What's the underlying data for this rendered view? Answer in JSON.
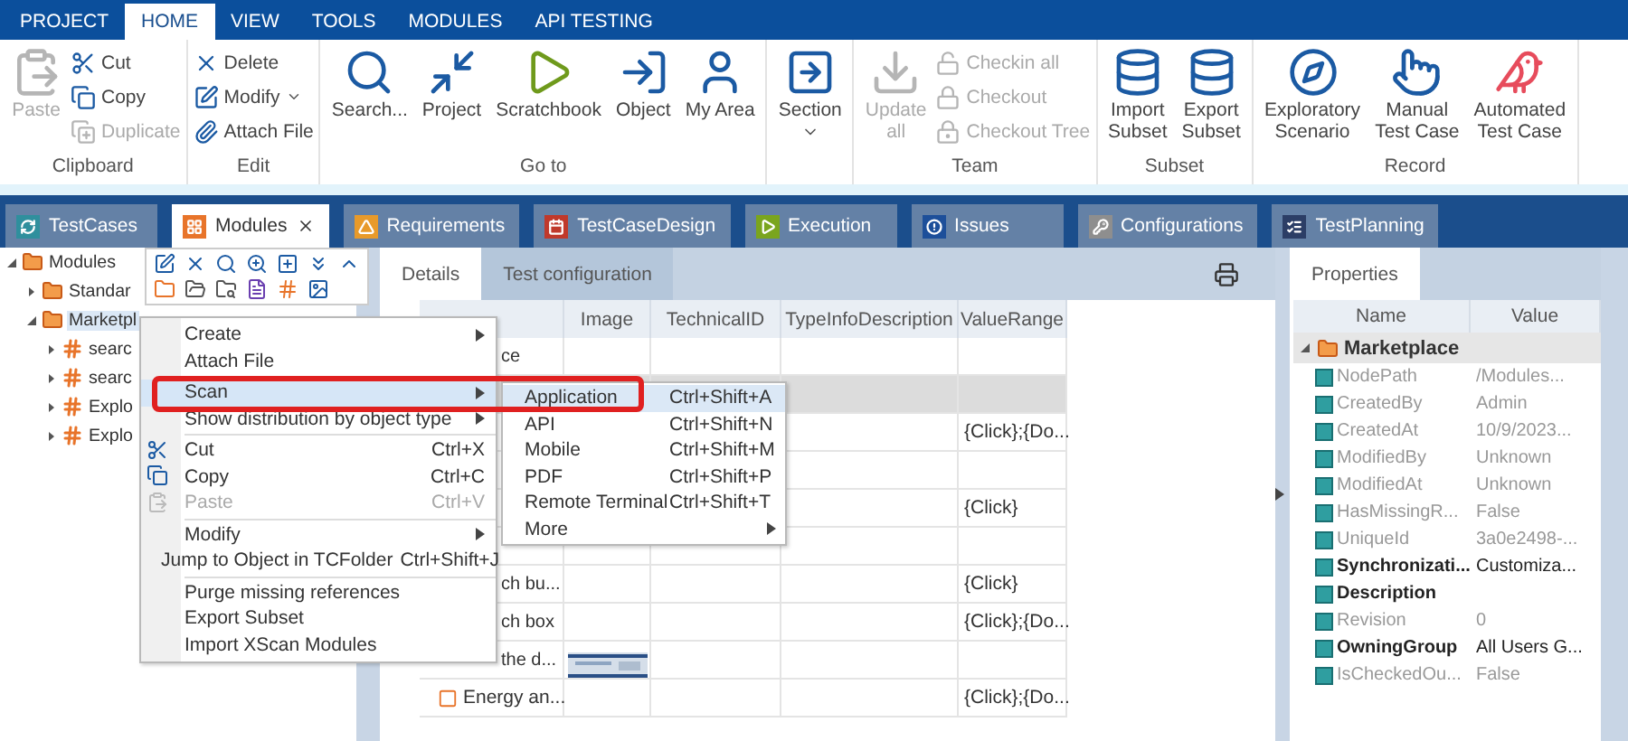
{
  "ribbon_tabs": [
    {
      "label": "PROJECT",
      "selected": false
    },
    {
      "label": "HOME",
      "selected": true
    },
    {
      "label": "VIEW",
      "selected": false
    },
    {
      "label": "TOOLS",
      "selected": false
    },
    {
      "label": "MODULES",
      "selected": false
    },
    {
      "label": "API TESTING",
      "selected": false
    }
  ],
  "ribbon_groups": [
    {
      "label": "Clipboard",
      "columns": [
        [
          {
            "label": "Paste",
            "disabled": true
          }
        ],
        [
          {
            "label": "Cut",
            "disabled": false
          },
          {
            "label": "Copy",
            "disabled": false
          },
          {
            "label": "Duplicate",
            "disabled": true
          }
        ]
      ]
    },
    {
      "label": "Edit",
      "columns": [
        [
          {
            "label": "Delete",
            "disabled": false
          },
          {
            "label": "Modify",
            "disabled": false,
            "dropdown": true
          },
          {
            "label": "Attach File",
            "disabled": false
          }
        ]
      ]
    },
    {
      "label": "Go to",
      "columns": [
        [
          {
            "label": "Search...",
            "disabled": false
          }
        ],
        [
          {
            "label": "Project",
            "disabled": false
          }
        ],
        [
          {
            "label": "Scratchbook",
            "disabled": false
          }
        ],
        [
          {
            "label": "Object",
            "disabled": false
          }
        ],
        [
          {
            "label": "My Area",
            "disabled": false
          }
        ]
      ]
    },
    {
      "columns": [
        [
          {
            "label": "Section",
            "disabled": false,
            "dropdown": true
          }
        ]
      ]
    },
    {
      "label": "Team",
      "columns": [
        [
          {
            "label": "Update\nall",
            "disabled": true
          }
        ],
        [
          {
            "label": "Checkin all",
            "disabled": true
          },
          {
            "label": "Checkout",
            "disabled": true
          },
          {
            "label": "Checkout Tree",
            "disabled": true
          }
        ]
      ]
    },
    {
      "label": "Subset",
      "columns": [
        [
          {
            "label": "Import\nSubset",
            "disabled": false
          }
        ],
        [
          {
            "label": "Export\nSubset",
            "disabled": false
          }
        ]
      ]
    },
    {
      "label": "Record",
      "columns": [
        [
          {
            "label": "Exploratory\nScenario",
            "disabled": false
          }
        ],
        [
          {
            "label": "Manual\nTest Case",
            "disabled": false
          }
        ],
        [
          {
            "label": "Automated\nTest Case",
            "disabled": false
          }
        ]
      ]
    }
  ],
  "doc_tabs": [
    {
      "label": "TestCases",
      "selected": false,
      "color": "#2f8f9d"
    },
    {
      "label": "Modules",
      "selected": true,
      "closable": true,
      "color": "#e8742a"
    },
    {
      "label": "Requirements",
      "selected": false,
      "color": "#e89a2a"
    },
    {
      "label": "TestCaseDesign",
      "selected": false,
      "color": "#c0392b"
    },
    {
      "label": "Execution",
      "selected": false,
      "color": "#7aa51e"
    },
    {
      "label": "Issues",
      "selected": false,
      "color": "#1d4f9a"
    },
    {
      "label": "Configurations",
      "selected": false,
      "color": "#8e8e8e"
    },
    {
      "label": "TestPlanning",
      "selected": false,
      "color": "#2c3e66"
    }
  ],
  "tree": [
    {
      "label": "Modules",
      "expanded": true,
      "selected": false,
      "kind": "folder",
      "children": [
        {
          "label": "Standar",
          "expanded": false,
          "selected": false,
          "kind": "folder"
        },
        {
          "label": "Marketpl",
          "expanded": true,
          "selected": true,
          "kind": "folder",
          "children": [
            {
              "label": "searc",
              "expanded": false,
              "selected": false,
              "kind": "module"
            },
            {
              "label": "searc",
              "expanded": false,
              "selected": false,
              "kind": "module"
            },
            {
              "label": "Explo",
              "expanded": false,
              "selected": false,
              "kind": "module"
            },
            {
              "label": "Explo",
              "expanded": false,
              "selected": false,
              "kind": "module"
            }
          ]
        }
      ]
    }
  ],
  "detail_tabs": [
    {
      "label": "Details",
      "selected": true
    },
    {
      "label": "Test configuration",
      "selected": false
    }
  ],
  "table": {
    "columns": [
      "Image",
      "TechnicalID",
      "TypeInfoDescription",
      "ValueRange"
    ],
    "rows": [
      {
        "name": "ce",
        "selected": false,
        "image": false
      },
      {
        "selected": true
      },
      {
        "selected": false,
        "value_range": "{Click};{Do..."
      },
      {
        "selected": false
      },
      {
        "selected": false,
        "value_range": "{Click}"
      },
      {
        "selected": false,
        "image": false
      },
      {
        "name": "ch bu...",
        "selected": false,
        "image": false,
        "value_range": "{Click}"
      },
      {
        "name": "ch box",
        "selected": false,
        "image": false,
        "value_range": "{Click};{Do..."
      },
      {
        "name": "the d...",
        "selected": false,
        "image": true
      },
      {
        "name": "Energy an...",
        "icon": true,
        "selected": false,
        "image": false,
        "value_range": "{Click};{Do..."
      }
    ]
  },
  "context_menu": {
    "highlight_frame": true,
    "groups": [
      [
        {
          "label": "Create",
          "submenu": true,
          "disabled": false,
          "selected": false
        },
        {
          "label": "Attach File",
          "disabled": false,
          "selected": false
        }
      ],
      [
        {
          "label": "Scan",
          "submenu": true,
          "disabled": false,
          "selected": true
        },
        {
          "label": "Show distribution by object type",
          "submenu": true,
          "disabled": false,
          "selected": false
        }
      ],
      [
        {
          "label": "Cut",
          "shortcut": "Ctrl+X",
          "disabled": false,
          "selected": false
        },
        {
          "label": "Copy",
          "shortcut": "Ctrl+C",
          "disabled": false,
          "selected": false
        },
        {
          "label": "Paste",
          "shortcut": "Ctrl+V",
          "disabled": true,
          "selected": false
        }
      ],
      [
        {
          "label": "Modify",
          "submenu": true,
          "disabled": false,
          "selected": false
        },
        {
          "label": "Jump to Object in TCFolder",
          "shortcut": "Ctrl+Shift+J",
          "disabled": false,
          "selected": false
        }
      ],
      [
        {
          "label": "Purge missing references",
          "disabled": false,
          "selected": false
        },
        {
          "label": "Export Subset",
          "disabled": false,
          "selected": false
        },
        {
          "label": "Import XScan Modules",
          "disabled": false,
          "selected": false
        }
      ]
    ]
  },
  "submenu": [
    {
      "label": "Application",
      "shortcut": "Ctrl+Shift+A",
      "selected": true
    },
    {
      "label": "API",
      "shortcut": "Ctrl+Shift+N",
      "selected": false
    },
    {
      "label": "Mobile",
      "shortcut": "Ctrl+Shift+M",
      "selected": false
    },
    {
      "label": "PDF",
      "shortcut": "Ctrl+Shift+P",
      "selected": false
    },
    {
      "label": "Remote Terminal",
      "shortcut": "Ctrl+Shift+T",
      "selected": false
    },
    {
      "label": "More",
      "submenu": true,
      "selected": false
    }
  ],
  "properties": {
    "tab": "Properties",
    "columns": [
      "Name",
      "Value"
    ],
    "group": {
      "label": "Marketplace",
      "expanded": true
    },
    "items": [
      {
        "name": "NodePath",
        "value": "/Modules...",
        "editable": false
      },
      {
        "name": "CreatedBy",
        "value": "Admin",
        "editable": false
      },
      {
        "name": "CreatedAt",
        "value": "10/9/2023...",
        "editable": false
      },
      {
        "name": "ModifiedBy",
        "value": "Unknown",
        "editable": false
      },
      {
        "name": "ModifiedAt",
        "value": "Unknown",
        "editable": false
      },
      {
        "name": "HasMissingR...",
        "value": "False",
        "editable": false
      },
      {
        "name": "UniqueId",
        "value": "3a0e2498-...",
        "editable": false
      },
      {
        "name": "Synchronizati...",
        "value": "Customiza...",
        "editable": true
      },
      {
        "name": "Description",
        "editable": true
      },
      {
        "name": "Revision",
        "value": "0",
        "editable": false
      },
      {
        "name": "OwningGroup",
        "value": "All Users G...",
        "editable": true
      },
      {
        "name": "IsCheckedOu...",
        "value": "False",
        "editable": false
      }
    ]
  }
}
